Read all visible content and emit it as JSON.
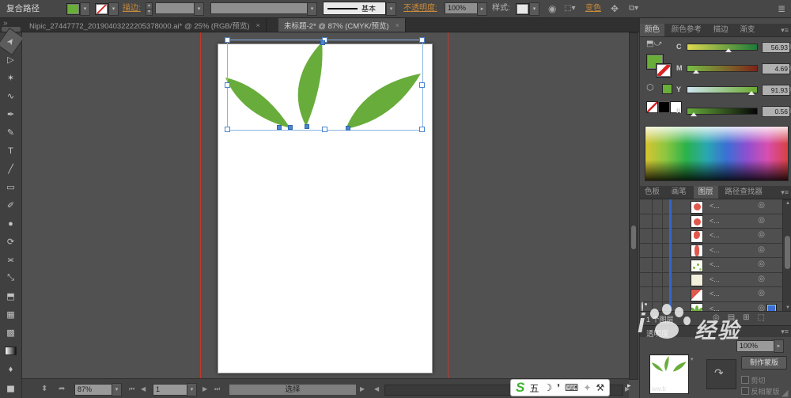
{
  "colors": {
    "accent_orange": "#c98a3a",
    "leaf_green": "#68ad3c",
    "selection_blue": "#7aa8d8",
    "guide_red": "#bf3a2b",
    "layer_blue": "#3366cc",
    "ime_green": "#3eb130"
  },
  "control_bar": {
    "selection_type": "复合路径",
    "stroke_label": "描边:",
    "stroke_style": "基本",
    "opacity_label": "不透明度:",
    "opacity_value": "100%",
    "style_label": "样式:",
    "recolor_label": "变色",
    "menu_icon": "≣"
  },
  "document_tabs": [
    {
      "title": "Nipic_27447772_20190403222205378000.ai* @ 25% (RGB/预览)",
      "close": "×",
      "active": false
    },
    {
      "title": "未标题-2* @ 87% (CMYK/预览)",
      "close": "×",
      "active": true
    }
  ],
  "tab_overflow_icon": "»",
  "toolbar": {
    "tools": [
      {
        "name": "selection-tool",
        "glyph": "➤",
        "active": true
      },
      {
        "name": "direct-selection-tool",
        "glyph": "▷",
        "active": false
      },
      {
        "name": "magic-wand-tool",
        "glyph": "✶",
        "active": false
      },
      {
        "name": "lasso-tool",
        "glyph": "∿",
        "active": false
      },
      {
        "name": "pen-tool",
        "glyph": "✒",
        "active": false
      },
      {
        "name": "pencil-tool",
        "glyph": "✎",
        "active": false
      },
      {
        "name": "type-tool",
        "glyph": "T",
        "active": false
      },
      {
        "name": "line-segment-tool",
        "glyph": "╱",
        "active": false
      },
      {
        "name": "rectangle-tool",
        "glyph": "▭",
        "active": false
      },
      {
        "name": "paintbrush-tool",
        "glyph": "✐",
        "active": false
      },
      {
        "name": "blob-brush-tool",
        "glyph": "●",
        "active": false
      },
      {
        "name": "rotate-tool",
        "glyph": "⟳",
        "active": false
      },
      {
        "name": "width-tool",
        "glyph": "≍",
        "active": false
      },
      {
        "name": "free-transform-tool",
        "glyph": "⤡",
        "active": false
      },
      {
        "name": "shape-builder-tool",
        "glyph": "⬒",
        "active": false
      },
      {
        "name": "perspective-grid-tool",
        "glyph": "▦",
        "active": false
      },
      {
        "name": "mesh-tool",
        "glyph": "▩",
        "active": false
      },
      {
        "name": "gradient-tool",
        "glyph": "",
        "active": false
      },
      {
        "name": "eyedropper-tool",
        "glyph": "♦",
        "active": false
      },
      {
        "name": "column-graph-tool",
        "glyph": "▅",
        "active": false
      }
    ]
  },
  "color_panel": {
    "tabs": [
      "颜色",
      "颜色参考",
      "描边",
      "渐变"
    ],
    "active_tab": "颜色",
    "menu_icon": "▾≡",
    "channels": [
      {
        "label": "C",
        "value": "56.93",
        "unit": "%",
        "pos": 55
      },
      {
        "label": "M",
        "value": "4.69",
        "unit": "%",
        "pos": 8
      },
      {
        "label": "Y",
        "value": "91.93",
        "unit": "%",
        "pos": 88
      },
      {
        "label": "K",
        "value": "0.56",
        "unit": "%",
        "pos": 4
      }
    ]
  },
  "layers_panel": {
    "tabs": [
      "色板",
      "画笔",
      "图层",
      "路径查找器"
    ],
    "active_tab": "图层",
    "menu_icon": "▾≡",
    "rows": [
      {
        "label": "<...",
        "thumb": "red-circle",
        "visible": false,
        "selected": false
      },
      {
        "label": "<...",
        "thumb": "red-circle",
        "visible": false,
        "selected": false
      },
      {
        "label": "<...",
        "thumb": "red-blob",
        "visible": false,
        "selected": false
      },
      {
        "label": "<...",
        "thumb": "red-half",
        "visible": false,
        "selected": false
      },
      {
        "label": "<...",
        "thumb": "green-specks",
        "visible": false,
        "selected": false
      },
      {
        "label": "<...",
        "thumb": "cream",
        "visible": false,
        "selected": false
      },
      {
        "label": "<...",
        "thumb": "red-diag",
        "visible": false,
        "selected": false
      },
      {
        "label": "<...",
        "thumb": "leaves",
        "visible": true,
        "selected": true
      }
    ],
    "footer_count": "1 个图层",
    "footer_icons": [
      "◎",
      "▤",
      "⊞",
      "⬚"
    ]
  },
  "transparency_panel": {
    "title": "透明度",
    "menu_icon": "▾≡",
    "opacity_value": "100%",
    "make_mask_label": "制作蒙版",
    "clip_label": "剪切",
    "invert_label": "反相蒙版"
  },
  "status_bar": {
    "zoom": "87%",
    "artboard_number": "1",
    "current_tool": "选择"
  },
  "ime_bar": {
    "logo": "S",
    "mode": "五",
    "icons": [
      "☽",
      "❜",
      "⌨",
      "✦",
      "⚒"
    ],
    "expand": "▸"
  },
  "watermark": {
    "prefix": "i",
    "text": "经验",
    "thumb_text": "ww.b"
  }
}
